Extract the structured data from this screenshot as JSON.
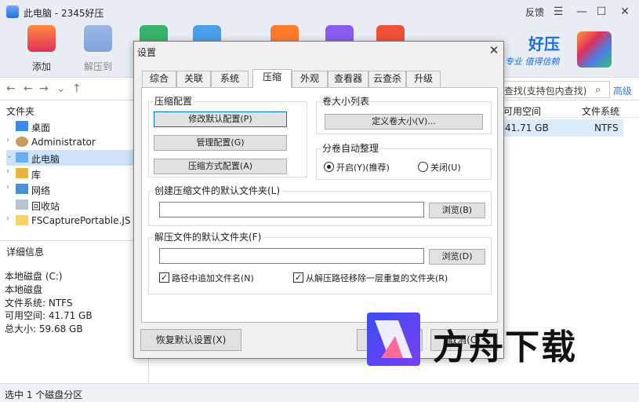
{
  "window": {
    "title": "此电脑 - 2345好压",
    "feedback": "反馈"
  },
  "toolbar": {
    "buttons": [
      {
        "label": "添加",
        "color": "#2f7fe8"
      },
      {
        "label": "解压到",
        "color": "#2f7fe8"
      }
    ],
    "brand_name": "好压",
    "brand_slogan": "专业 值得信赖"
  },
  "addrbar": {
    "search_placeholder": "查找(支持包内查找)",
    "advanced": "高级"
  },
  "sidebar": {
    "header": "文件夹",
    "items": [
      {
        "label": "桌面",
        "icon": "desktop-icon"
      },
      {
        "label": "Administrator",
        "icon": "user-icon"
      },
      {
        "label": "此电脑",
        "icon": "computer-icon"
      },
      {
        "label": "库",
        "icon": "library-icon"
      },
      {
        "label": "网络",
        "icon": "network-icon"
      },
      {
        "label": "回收站",
        "icon": "recycle-bin-icon"
      },
      {
        "label": "FSCapturePortable.JS",
        "icon": "file-icon"
      }
    ],
    "details_header": "详细信息",
    "details": [
      "本地磁盘 (C:)",
      "本地磁盘",
      "文件系统: NTFS",
      "可用空间: 41.71 GB",
      "总大小: 59.68 GB"
    ]
  },
  "list": {
    "columns": [
      "可用空间",
      "文件系统"
    ],
    "row": {
      "free": "41.71 GB",
      "fs": "NTFS"
    }
  },
  "statusbar": {
    "text": "选中 1 个磁盘分区"
  },
  "dialog": {
    "title": "设置",
    "tabs": [
      "综合",
      "关联",
      "系统",
      "压缩",
      "外观",
      "查看器",
      "云查杀",
      "升级"
    ],
    "active_tab": "压缩",
    "profile_group": {
      "title": "压缩配置",
      "buttons": [
        "修改默认配置(P)",
        "管理配置(G)",
        "压缩方式配置(A)"
      ]
    },
    "volume_group": {
      "title": "卷大小列表",
      "button": "定义卷大小(V)..."
    },
    "split_group": {
      "title": "分卷自动整理",
      "on": "开启(Y)(推荐)",
      "off": "关闭(U)"
    },
    "create_default": {
      "title": "创建压缩文件的默认文件夹(L)",
      "value": "",
      "browse": "浏览(B)"
    },
    "extract_default": {
      "title": "解压文件的默认文件夹(F)",
      "value": "",
      "browse": "浏览(D)",
      "check1": "路径中追加文件名(N)",
      "check2": "从解压路径移除一层重复的文件夹(R)"
    },
    "restore": "恢复默认设置(X)",
    "cancel": "取消(C)"
  },
  "watermark": {
    "text": "方舟下载"
  }
}
